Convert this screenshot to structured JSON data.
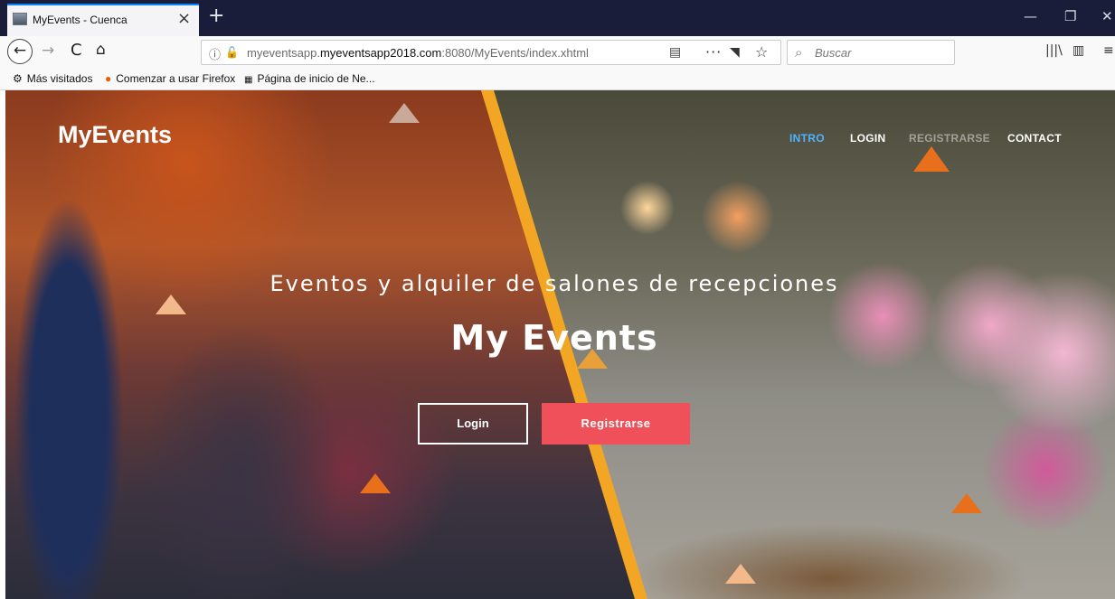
{
  "browser": {
    "tab_title": "MyEvents - Cuenca",
    "tab_close": "×",
    "new_tab": "+",
    "window_controls": {
      "minimize": "—",
      "restore": "❐",
      "close": "✕"
    },
    "nav": {
      "back": "←",
      "forward": "→",
      "reload": "C",
      "home": "⌂"
    },
    "url": {
      "prefix": "myeventsapp.",
      "host": "myeventsapp2018.com",
      "rest": ":8080/MyEvents/index.xhtml"
    },
    "search_placeholder": "Buscar",
    "bookmarks": [
      {
        "label": "Más visitados",
        "icon": "gear-icon"
      },
      {
        "label": "Comenzar a usar Firefox",
        "icon": "firefox-icon"
      },
      {
        "label": "Página de inicio de Ne...",
        "icon": "grid-icon"
      }
    ]
  },
  "site": {
    "brand": "MyEvents",
    "menu": [
      {
        "label": "INTRO",
        "state": "active"
      },
      {
        "label": "LOGIN",
        "state": "normal"
      },
      {
        "label": "REGISTRARSE",
        "state": "faint"
      },
      {
        "label": "CONTACT",
        "state": "normal"
      }
    ],
    "hero": {
      "subtitle": "Eventos y alquiler de salones de recepciones",
      "title": "My Events",
      "login_button": "Login",
      "register_button": "Registrarse"
    },
    "colors": {
      "accent_active": "#4fb3ff",
      "register_button": "#f0505a",
      "diagonal_stripe": "#f2a623",
      "triangle_orange": "#e8701c",
      "triangle_light": "#f4b98a"
    }
  }
}
